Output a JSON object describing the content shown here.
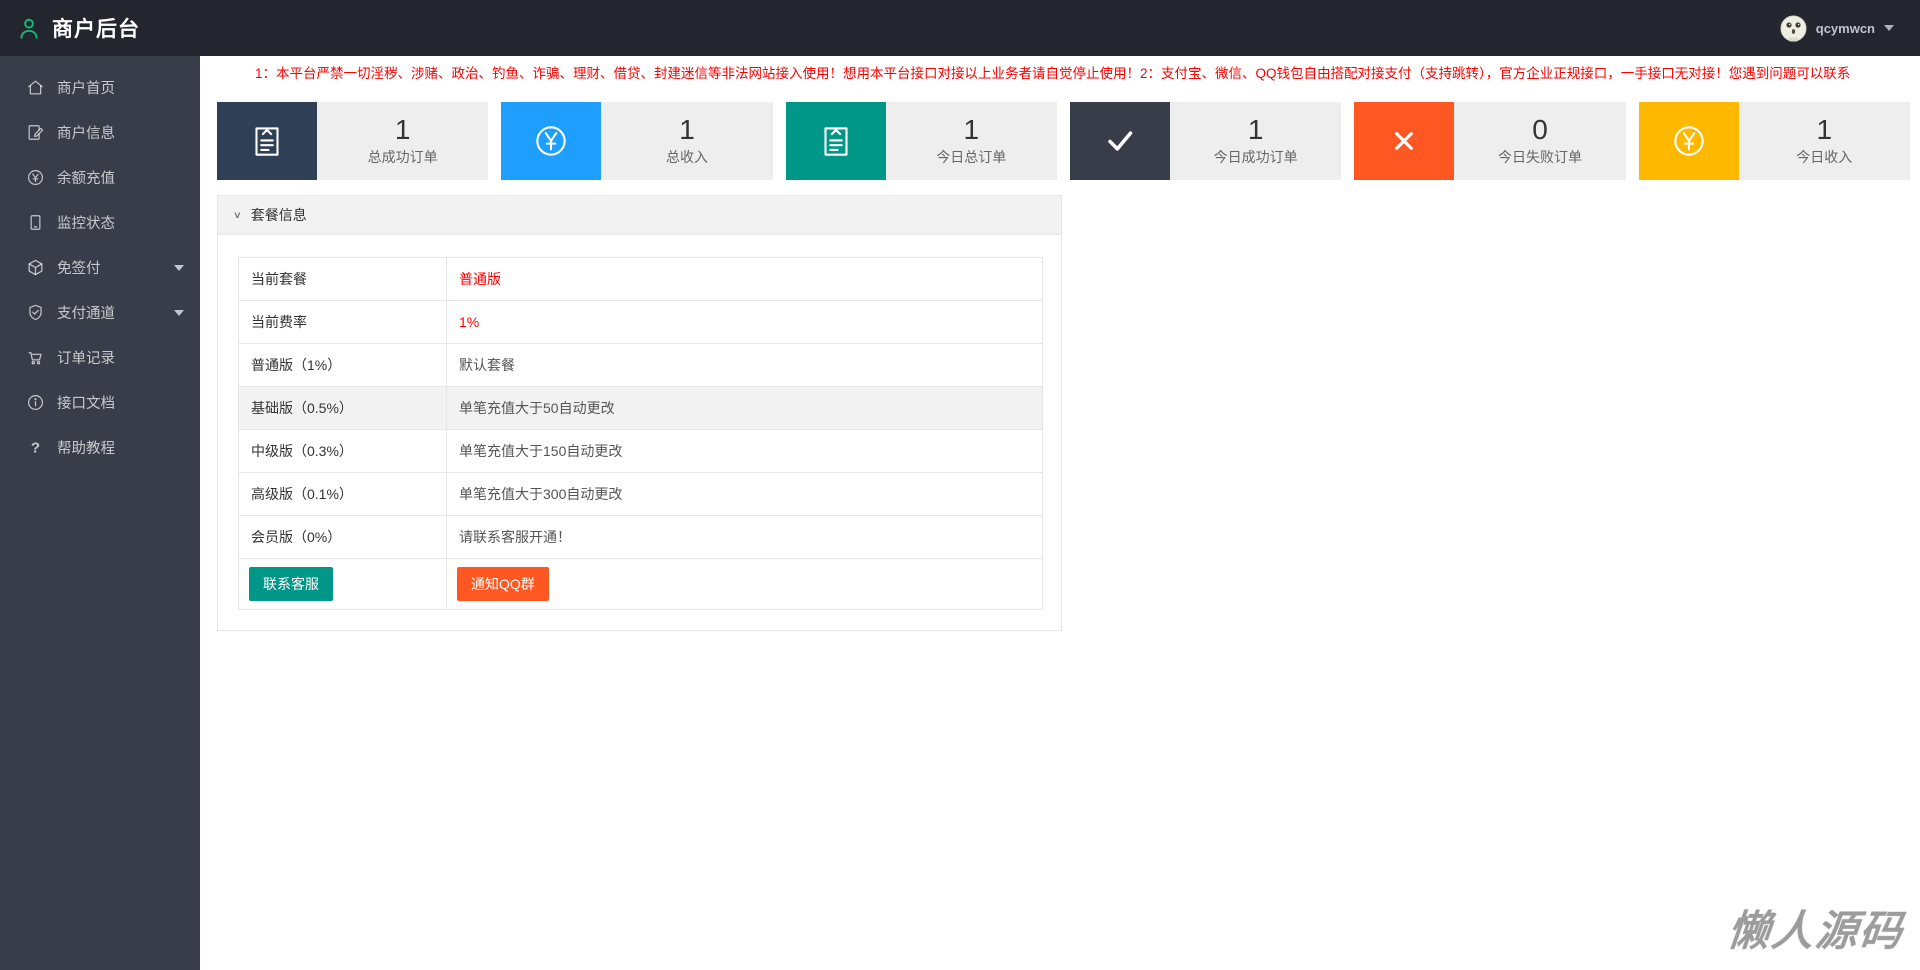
{
  "header": {
    "title": "商户后台",
    "username": "qcymwcn"
  },
  "sidebar": {
    "items": [
      {
        "label": "商户首页",
        "icon": "home",
        "expand": false
      },
      {
        "label": "商户信息",
        "icon": "edit-doc",
        "expand": false
      },
      {
        "label": "余额充值",
        "icon": "yen-circle",
        "expand": false
      },
      {
        "label": "监控状态",
        "icon": "monitor",
        "expand": false
      },
      {
        "label": "免签付",
        "icon": "cube",
        "expand": true
      },
      {
        "label": "支付通道",
        "icon": "shield-check",
        "expand": true
      },
      {
        "label": "订单记录",
        "icon": "cart",
        "expand": false
      },
      {
        "label": "接口文档",
        "icon": "info-circle",
        "expand": false
      },
      {
        "label": "帮助教程",
        "icon": "question",
        "expand": false
      }
    ]
  },
  "notice": {
    "text": "1：本平台严禁一切淫秽、涉赌、政治、钓鱼、诈骗、理财、借贷、封建迷信等非法网站接入使用！想用本平台接口对接以上业务者请自觉停止使用！2：支付宝、微信、QQ钱包自由搭配对接支付（支持跳转），官方企业正规接口，一手接口无对接！您遇到问题可以联系"
  },
  "stats": [
    {
      "value": "1",
      "label": "总成功订单",
      "icon": "clipboard",
      "color": "#2F4056"
    },
    {
      "value": "1",
      "label": "总收入",
      "icon": "yen",
      "color": "#1E9FFF"
    },
    {
      "value": "1",
      "label": "今日总订单",
      "icon": "clipboard",
      "color": "#009688"
    },
    {
      "value": "1",
      "label": "今日成功订单",
      "icon": "check",
      "color": "#393D49"
    },
    {
      "value": "0",
      "label": "今日失败订单",
      "icon": "close",
      "color": "#FF5722"
    },
    {
      "value": "1",
      "label": "今日收入",
      "icon": "yen",
      "color": "#FFB800"
    }
  ],
  "panel": {
    "title": "套餐信息",
    "rows": [
      {
        "name": "当前套餐",
        "value": "普通版",
        "red": true,
        "highlight": false
      },
      {
        "name": "当前费率",
        "value": "1%",
        "red": true,
        "highlight": false
      },
      {
        "name": "普通版（1%）",
        "value": "默认套餐",
        "red": false,
        "highlight": false
      },
      {
        "name": "基础版（0.5%）",
        "value": "单笔充值大于50自动更改",
        "red": false,
        "highlight": true
      },
      {
        "name": "中级版（0.3%）",
        "value": "单笔充值大于150自动更改",
        "red": false,
        "highlight": false
      },
      {
        "name": "高级版（0.1%）",
        "value": "单笔充值大于300自动更改",
        "red": false,
        "highlight": false
      },
      {
        "name": "会员版（0%）",
        "value": "请联系客服开通！",
        "red": false,
        "highlight": false
      }
    ],
    "buttons": [
      {
        "label": "联系客服",
        "color": "#009688"
      },
      {
        "label": "通知QQ群",
        "color": "#FF5722"
      }
    ]
  },
  "watermark": {
    "text": "懒人源码"
  },
  "colors": {
    "header_bg": "#23262e",
    "sidebar_bg": "#393D49",
    "logo_accent": "#16b777",
    "notice_red": "#ff0000"
  }
}
